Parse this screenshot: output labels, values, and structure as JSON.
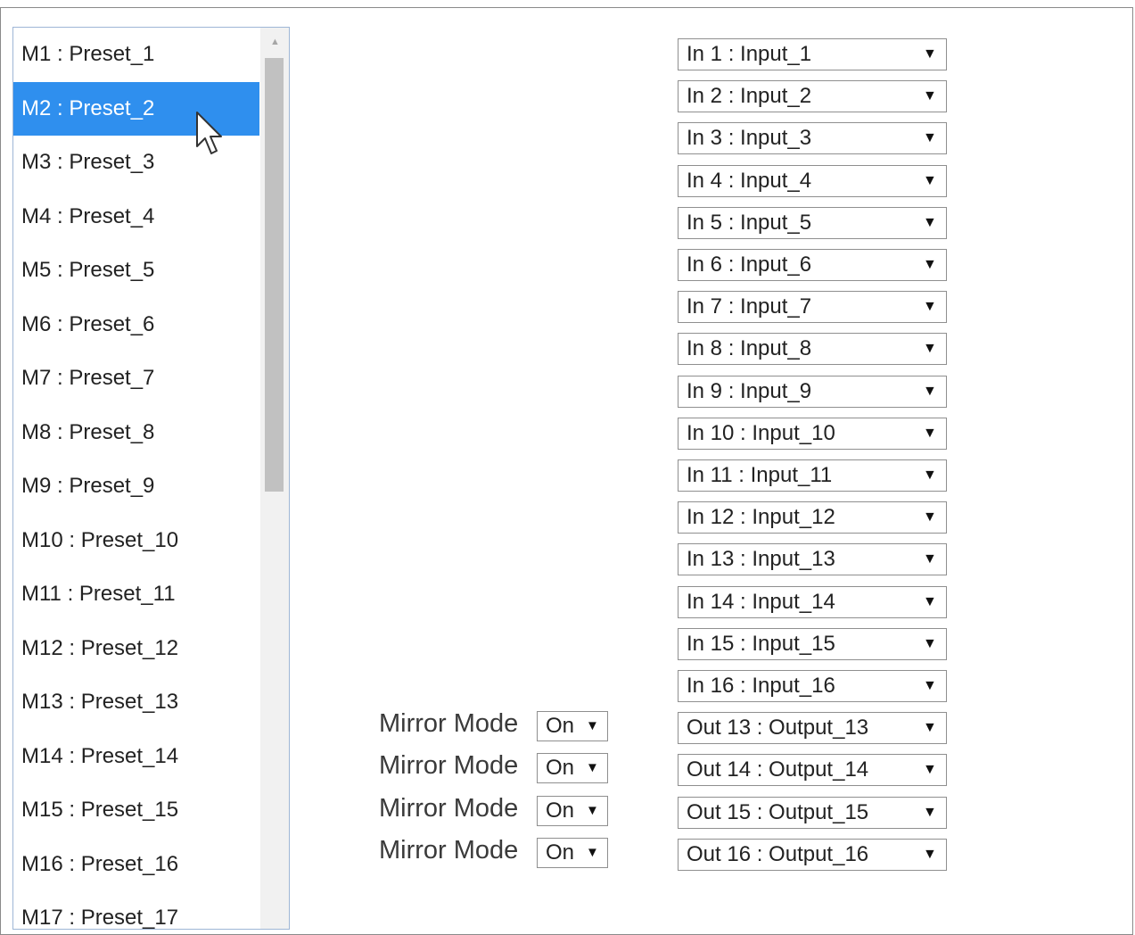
{
  "presets": [
    {
      "label": "M1 : Preset_1"
    },
    {
      "label": "M2 : Preset_2",
      "selected": true
    },
    {
      "label": "M3 : Preset_3"
    },
    {
      "label": "M4 : Preset_4"
    },
    {
      "label": "M5 : Preset_5"
    },
    {
      "label": "M6 : Preset_6"
    },
    {
      "label": "M7 : Preset_7"
    },
    {
      "label": "M8 : Preset_8"
    },
    {
      "label": "M9 : Preset_9"
    },
    {
      "label": "M10 : Preset_10"
    },
    {
      "label": "M11 : Preset_11"
    },
    {
      "label": "M12 : Preset_12"
    },
    {
      "label": "M13 : Preset_13"
    },
    {
      "label": "M14 : Preset_14"
    },
    {
      "label": "M15 : Preset_15"
    },
    {
      "label": "M16 : Preset_16"
    },
    {
      "label": "M17 : Preset_17"
    }
  ],
  "routing": [
    "In 1 : Input_1",
    "In 2 : Input_2",
    "In 3 : Input_3",
    "In 4 : Input_4",
    "In 5 : Input_5",
    "In 6 : Input_6",
    "In 7 : Input_7",
    "In 8 : Input_8",
    "In 9 : Input_9",
    "In 10 : Input_10",
    "In 11 : Input_11",
    "In 12 : Input_12",
    "In 13 : Input_13",
    "In 14 : Input_14",
    "In 15 : Input_15",
    "In 16 : Input_16",
    "Out 13 : Output_13",
    "Out 14 : Output_14",
    "Out 15 : Output_15",
    "Out 16 : Output_16"
  ],
  "mirror": [
    {
      "label": "Mirror Mode",
      "value": "On"
    },
    {
      "label": "Mirror Mode",
      "value": "On"
    },
    {
      "label": "Mirror Mode",
      "value": "On"
    },
    {
      "label": "Mirror Mode",
      "value": "On"
    }
  ],
  "icons": {
    "dropdown_arrow": "▼",
    "scroll_up": "▲",
    "cursor": "mouse-pointer-icon"
  },
  "colors": {
    "selected_bg": "#2f8fee",
    "selected_text": "#ffffff"
  }
}
